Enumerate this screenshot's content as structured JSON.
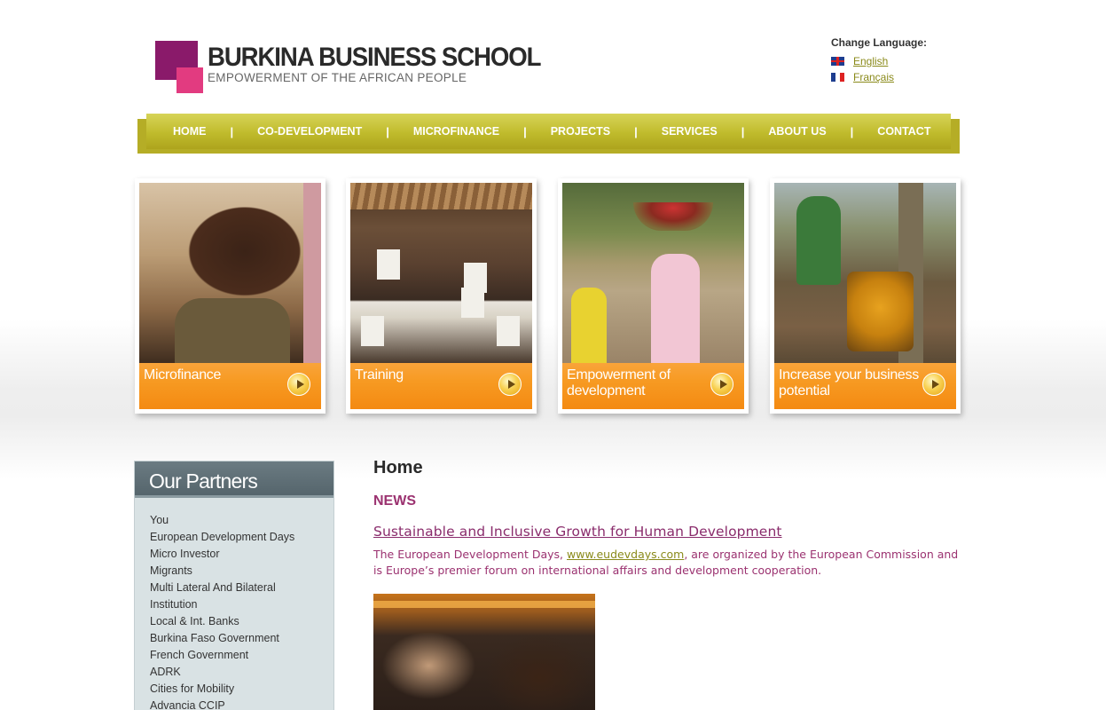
{
  "header": {
    "title": "BURKINA BUSINESS SCHOOL",
    "tagline": "EMPOWERMENT OF THE AFRICAN PEOPLE",
    "colors": {
      "logo_dark": "#8a1a6a",
      "logo_light": "#e23b80"
    }
  },
  "language": {
    "title": "Change Language:",
    "options": [
      {
        "label": "English",
        "flag": "uk-flag-icon"
      },
      {
        "label": "Français",
        "flag": "fr-flag-icon"
      }
    ]
  },
  "nav": {
    "items": [
      "HOME",
      "CO-DEVELOPMENT",
      "MICROFINANCE",
      "PROJECTS",
      "SERVICES",
      "ABOUT US",
      "CONTACT"
    ],
    "separator": "|",
    "color": "#c0bb2c"
  },
  "tiles": [
    {
      "label": "Microfinance",
      "icon": "arrow-right-icon"
    },
    {
      "label": "Training",
      "icon": "arrow-right-icon"
    },
    {
      "label": "Empowerment of development",
      "icon": "arrow-right-icon"
    },
    {
      "label": "Increase your business potential",
      "icon": "arrow-right-icon"
    }
  ],
  "partners": {
    "title": "Our Partners",
    "items": [
      "You",
      "European Development Days",
      "Micro Investor",
      "Migrants",
      "Multi Lateral And Bilateral",
      "Institution",
      "Local & Int. Banks",
      "Burkina Faso Government",
      "French Government",
      "ADRK",
      "Cities for Mobility",
      "Advancia CCIP"
    ]
  },
  "main": {
    "heading": "Home",
    "section": "NEWS",
    "news_title": "Sustainable and Inclusive Growth for Human Development",
    "news_body_before": "The European Development Days, ",
    "news_link": "www.eudevdays.com",
    "news_body_after": ", are organized by the European Commission and is Europe’s premier forum on international affairs and development cooperation."
  }
}
